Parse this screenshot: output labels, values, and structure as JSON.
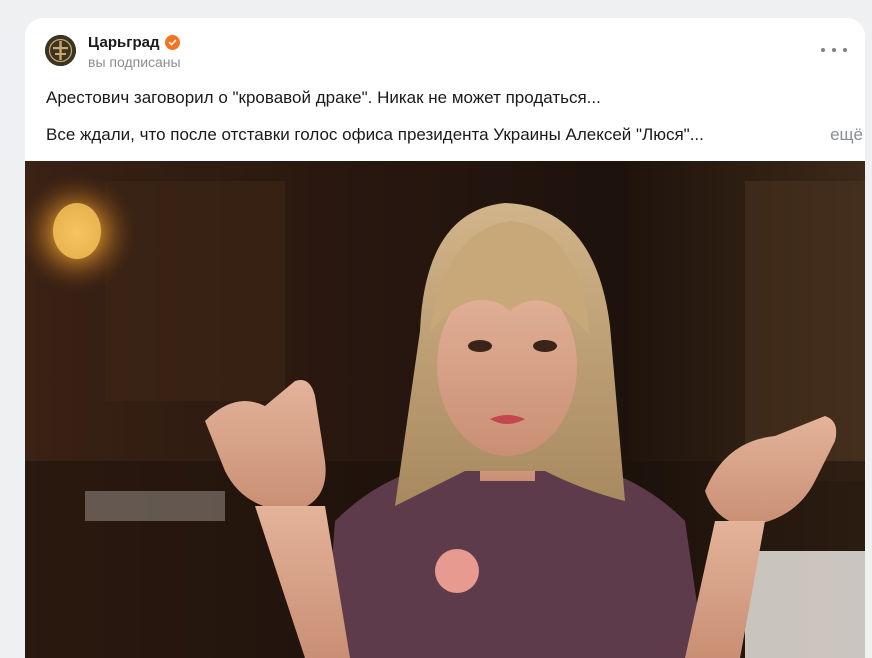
{
  "channel": {
    "name": "Царьград",
    "status": "вы подписаны",
    "verified": true
  },
  "post": {
    "title": "Арестович заговорил о \"кровавой драке\". Никак не может продаться...",
    "snippet": "Все ждали, что после отставки голос офиса президента Украины Алексей \"Люся\"...",
    "more_label": "ещё"
  },
  "icons": {
    "avatar": "tsargrad-logo-icon",
    "verified": "verified-check-icon",
    "more": "more-horizontal-icon"
  },
  "colors": {
    "card_bg": "#ffffff",
    "page_bg": "#eef0f2",
    "verified_badge": "#f5731e",
    "secondary_text": "#8a8d93"
  }
}
